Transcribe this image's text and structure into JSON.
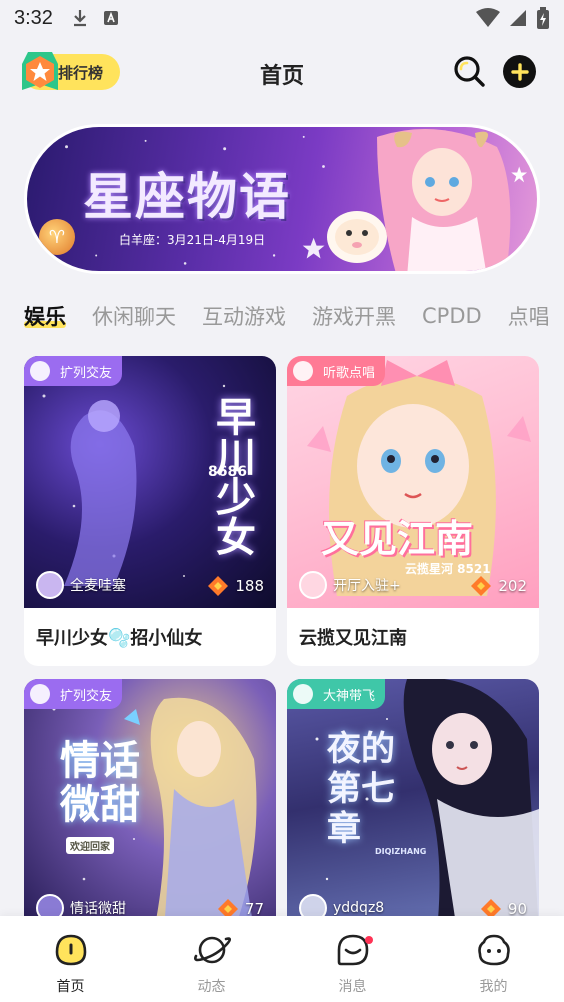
{
  "status_bar": {
    "time": "3:32"
  },
  "header": {
    "rank_label": "排行榜",
    "title": "首页",
    "search_icon": "search-icon",
    "add_icon": "plus-icon"
  },
  "banner": {
    "title": "星座物语",
    "subtitle": "白羊座：3月21日-4月19日"
  },
  "tabs": [
    {
      "label": "娱乐",
      "active": true
    },
    {
      "label": "休闲聊天"
    },
    {
      "label": "互动游戏"
    },
    {
      "label": "游戏开黑"
    },
    {
      "label": "CPDD"
    },
    {
      "label": "点唱"
    }
  ],
  "cards": [
    {
      "tag": "扩列交友",
      "tag_color": "#9b6cf0",
      "host": "全麦哇塞",
      "heat": "188",
      "title": "早川少女🫧招小仙女",
      "poster_text": "早川少女",
      "poster_sub": "8686"
    },
    {
      "tag": "听歌点唱",
      "tag_color": "#ff7a95",
      "host": "开厅入驻+",
      "heat": "202",
      "title": "云揽又见江南",
      "poster_text": "又见江南",
      "poster_sub": "云揽星河 8521"
    },
    {
      "tag": "扩列交友",
      "tag_color": "#9b6cf0",
      "host": "情话微甜",
      "heat": "77",
      "title": "",
      "poster_text": "情话微甜",
      "poster_sub": "欢迎回家"
    },
    {
      "tag": "大神带飞",
      "tag_color": "#3fc7a8",
      "host": "yddqz8",
      "heat": "90",
      "title": "",
      "poster_text": "夜的第七章",
      "poster_sub": "DIQIZHANG"
    }
  ],
  "bottom_nav": [
    {
      "label": "首页",
      "icon": "home-icon",
      "active": true
    },
    {
      "label": "动态",
      "icon": "planet-icon"
    },
    {
      "label": "消息",
      "icon": "message-icon",
      "badge": true
    },
    {
      "label": "我的",
      "icon": "profile-icon"
    }
  ]
}
